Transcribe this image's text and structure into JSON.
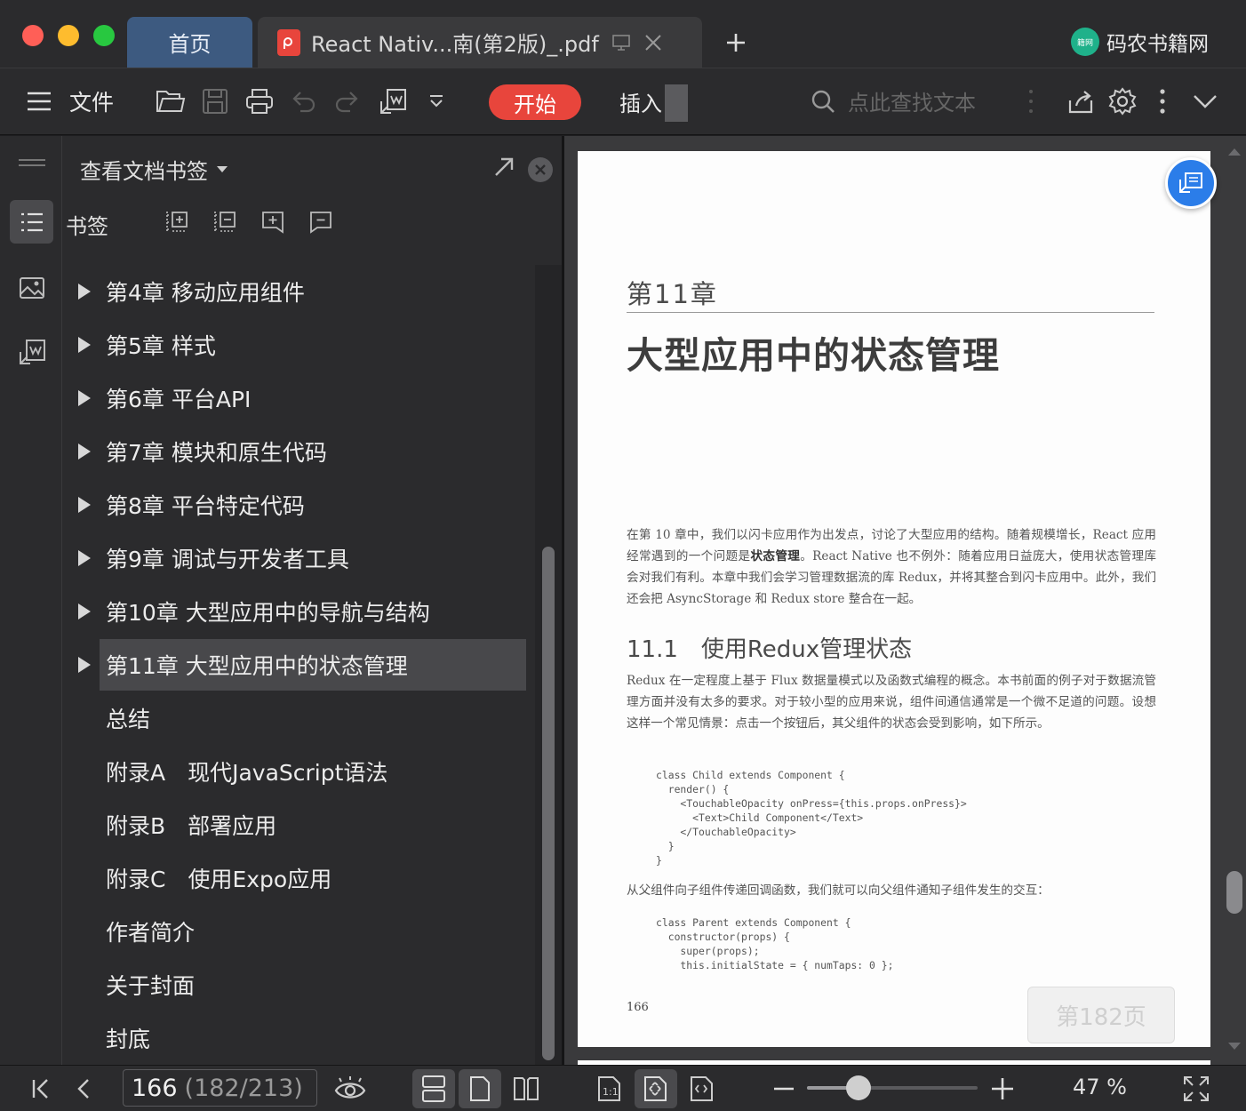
{
  "tabs": {
    "home_label": "首页",
    "document_title": "React Nativ...南(第2版)_.pdf"
  },
  "brand": {
    "name": "码农书籍网",
    "logo_text": "籍网"
  },
  "toolbar": {
    "file_label": "文件",
    "start_label": "开始",
    "insert_label": "插入",
    "search_placeholder": "点此查找文本",
    "icons": [
      "menu-icon",
      "open-folder-icon",
      "save-icon",
      "print-icon",
      "undo-icon",
      "redo-icon",
      "export-icon",
      "dropdown-icon",
      "search-icon",
      "share-icon",
      "settings-icon",
      "more-icon",
      "collapse-icon"
    ]
  },
  "sidebar": {
    "header_label": "查看文档书签",
    "bookmark_label": "书签",
    "items": [
      {
        "label": "第4章 移动应用组件",
        "expandable": true,
        "selected": false
      },
      {
        "label": "第5章 样式",
        "expandable": true,
        "selected": false
      },
      {
        "label": "第6章 平台API",
        "expandable": true,
        "selected": false
      },
      {
        "label": "第7章 模块和原生代码",
        "expandable": true,
        "selected": false
      },
      {
        "label": "第8章 平台特定代码",
        "expandable": true,
        "selected": false
      },
      {
        "label": "第9章 调试与开发者工具",
        "expandable": true,
        "selected": false
      },
      {
        "label": "第10章 大型应用中的导航与结构",
        "expandable": true,
        "selected": false
      },
      {
        "label": "第11章 大型应用中的状态管理",
        "expandable": true,
        "selected": true
      },
      {
        "label": "总结",
        "expandable": false,
        "selected": false
      },
      {
        "label": "附录A　现代JavaScript语法",
        "expandable": false,
        "selected": false
      },
      {
        "label": "附录B　部署应用",
        "expandable": false,
        "selected": false
      },
      {
        "label": "附录C　使用Expo应用",
        "expandable": false,
        "selected": false
      },
      {
        "label": "作者简介",
        "expandable": false,
        "selected": false
      },
      {
        "label": "关于封面",
        "expandable": false,
        "selected": false
      },
      {
        "label": "封底",
        "expandable": false,
        "selected": false
      }
    ]
  },
  "page": {
    "chapter": "第11章",
    "title": "大型应用中的状态管理",
    "intro_before_bold": "在第 10 章中，我们以闪卡应用作为出发点，讨论了大型应用的结构。随着规模增长，React 应用经常遇到的一个问题是",
    "intro_bold": "状态管理",
    "intro_after_bold": "。React Native 也不例外：随着应用日益庞大，使用状态管理库会对我们有利。本章中我们会学习管理数据流的库 Redux，并将其整合到闪卡应用中。此外，我们还会把 AsyncStorage 和 Redux store 整合在一起。",
    "section_number": "11.1",
    "section_title": "使用Redux管理状态",
    "section_para": "Redux 在一定程度上基于 Flux 数据量模式以及函数式编程的概念。本书前面的例子对于数据流管理方面并没有太多的要求。对于较小型的应用来说，组件间通信通常是一个微不足道的问题。设想这样一个常见情景：点击一个按钮后，其父组件的状态会受到影响，如下所示。",
    "code_1": "class Child extends Component {\n  render() {\n    <TouchableOpacity onPress={this.props.onPress}>\n      <Text>Child Component</Text>\n    </TouchableOpacity>\n  }\n}",
    "middle_para": "从父组件向子组件传递回调函数，我们就可以向父组件通知子组件发生的交互：",
    "code_2": "class Parent extends Component {\n  constructor(props) {\n    super(props);\n    this.initialState = { numTaps: 0 };",
    "page_number": "166",
    "page_badge": "第182页"
  },
  "status": {
    "current_page": "166",
    "page_of_total": "(182/213)",
    "zoom_label": "47 %",
    "zoom_fraction": 0.3
  }
}
